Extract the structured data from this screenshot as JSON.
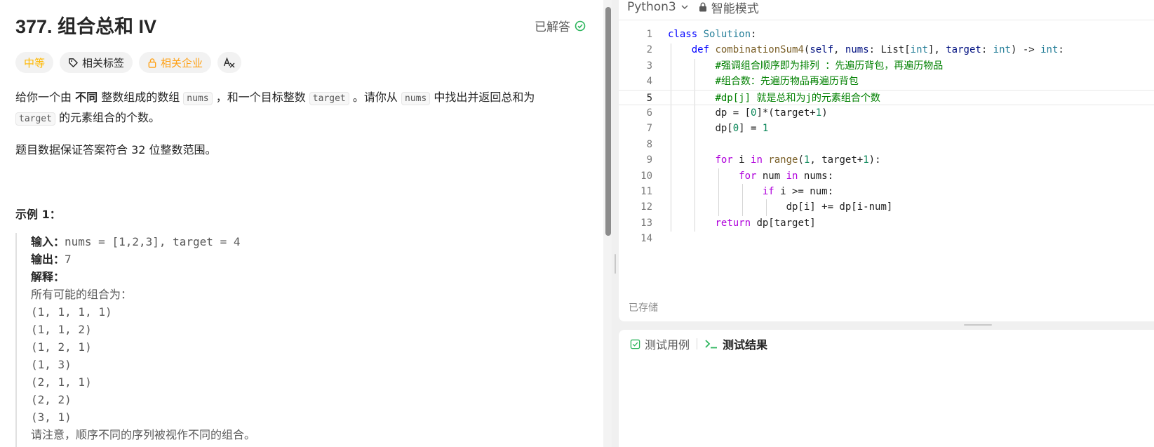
{
  "problem": {
    "title": "377. 组合总和 IV",
    "status": "已解答",
    "tags": {
      "difficulty": "中等",
      "topics": "相关标签",
      "companies": "相关企业",
      "translate": "A"
    },
    "desc": {
      "p1_a": "给你一个由 ",
      "p1_b": "不同",
      "p1_c": " 整数组成的数组 ",
      "p1_code1": "nums",
      "p1_d": " ，和一个目标整数 ",
      "p1_code2": "target",
      "p1_e": " 。请你从 ",
      "p1_code3": "nums",
      "p1_f": " 中找出并返回总和为 ",
      "p1_code4": "target",
      "p1_g": " 的元素组合的个数。",
      "p2": "题目数据保证答案符合 32 位整数范围。"
    },
    "example": {
      "title": "示例 1：",
      "input_label": "输入：",
      "input_value": "nums = [1,2,3], target = 4",
      "output_label": "输出：",
      "output_value": "7",
      "explain_label": "解释：",
      "lines": [
        "所有可能的组合为：",
        "(1, 1, 1, 1)",
        "(1, 1, 2)",
        "(1, 2, 1)",
        "(1, 3)",
        "(2, 1, 1)",
        "(2, 2)",
        "(3, 1)",
        "请注意，顺序不同的序列被视作不同的组合。"
      ]
    }
  },
  "editor": {
    "language": "Python3",
    "mode": "智能模式",
    "saved": "已存储",
    "line_numbers": [
      "1",
      "2",
      "3",
      "4",
      "5",
      "6",
      "7",
      "8",
      "9",
      "10",
      "11",
      "12",
      "13",
      "14"
    ],
    "active_line": 5,
    "code": {
      "l1_kw": "class",
      "l1_cls": "Solution",
      "l1_rest": ":",
      "l2_def": "def",
      "l2_fn": "combinationSum4",
      "l2_open": "(",
      "l2_self": "self",
      "l2_c1": ", ",
      "l2_nums": "nums",
      "l2_c2": ": List[",
      "l2_int1": "int",
      "l2_c3": "], ",
      "l2_target": "target",
      "l2_c4": ": ",
      "l2_int2": "int",
      "l2_c5": ") -> ",
      "l2_int3": "int",
      "l2_c6": ":",
      "l3": "#强调组合顺序即为排列 ：先遍历背包，再遍历物品",
      "l4": "#组合数：先遍历物品再遍历背包",
      "l5": "#dp[j] 就是总和为j的元素组合个数",
      "l6_a": "dp = [",
      "l6_n0": "0",
      "l6_b": "]*(target+",
      "l6_n1": "1",
      "l6_c": ")",
      "l7_a": "dp[",
      "l7_n0": "0",
      "l7_b": "] = ",
      "l7_n1": "1",
      "l9_for": "for",
      "l9_a": " i ",
      "l9_in": "in",
      "l9_sp": " ",
      "l9_range": "range",
      "l9_b": "(",
      "l9_n1": "1",
      "l9_c": ", target+",
      "l9_n2": "1",
      "l9_d": "):",
      "l10_for": "for",
      "l10_a": " num ",
      "l10_in": "in",
      "l10_b": " nums:",
      "l11_if": "if",
      "l11_a": " i >= num:",
      "l12": "dp[i] += dp[i-num]",
      "l13_ret": "return",
      "l13_a": " dp[target]"
    }
  },
  "console": {
    "tab_cases": "测试用例",
    "tab_result": "测试结果"
  },
  "colors": {
    "medium": "#ffb800",
    "company": "#ffa116",
    "solved": "#2db55d",
    "keyword": "#af00db",
    "comment": "#008000",
    "number": "#098658"
  }
}
